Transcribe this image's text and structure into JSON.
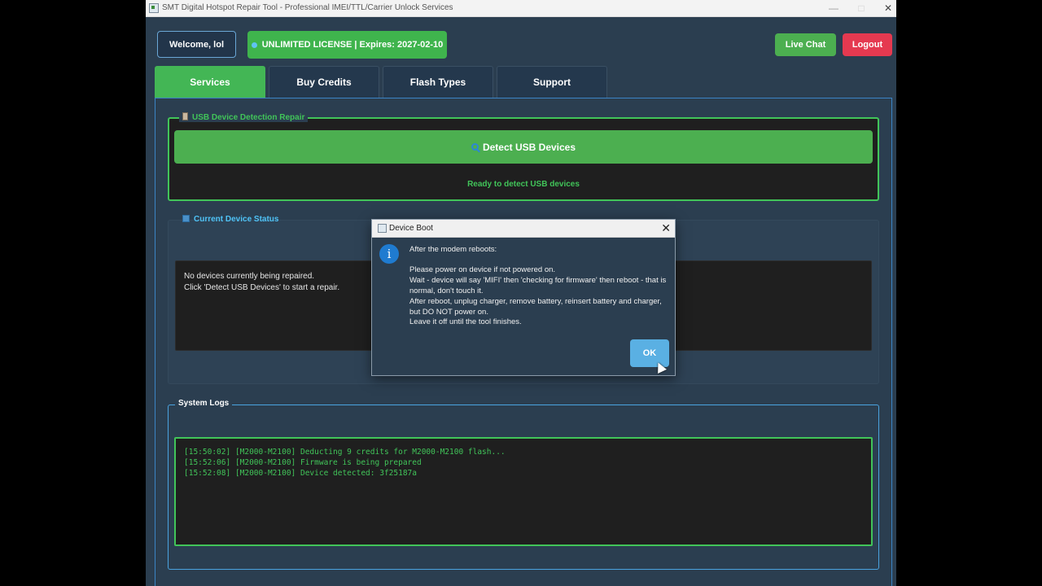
{
  "window": {
    "title": "SMT Digital Hotspot Repair Tool - Professional IMEI/TTL/Carrier Unlock Services",
    "controls": {
      "minimize": "—",
      "maximize": "□",
      "close": "✕"
    }
  },
  "header": {
    "welcome": "Welcome, lol",
    "license": "UNLIMITED LICENSE | Expires: 2027-02-10",
    "live_chat": "Live Chat",
    "logout": "Logout"
  },
  "tabs": [
    {
      "label": "Services",
      "active": true
    },
    {
      "label": "Buy Credits",
      "active": false
    },
    {
      "label": "Flash Types",
      "active": false
    },
    {
      "label": "Support",
      "active": false
    }
  ],
  "usb_section": {
    "title": "USB Device Detection  Repair",
    "detect_button": "Detect USB Devices",
    "status": "Ready to detect USB devices"
  },
  "device_status": {
    "title": "Current Device Status",
    "lines": [
      "No devices currently being repaired.",
      "Click 'Detect USB Devices' to start a repair."
    ]
  },
  "system_logs": {
    "title": "System Logs",
    "entries": [
      "[15:50:02] [M2000-M2100] Deducting 9 credits for M2000-M2100 flash...",
      "[15:52:06] [M2000-M2100] Firmware is being prepared",
      "[15:52:08] [M2000-M2100] Device detected: 3f25187a"
    ]
  },
  "dialog": {
    "title": "Device Boot",
    "close": "✕",
    "icon": "info-icon",
    "heading": "After the modem reboots:",
    "lines": [
      "Please power on device if not powered on.",
      "Wait - device will say 'MIFI' then 'checking for firmware' then reboot - that is normal, don't touch it.",
      "After reboot, unplug charger, remove battery, reinsert battery and charger, but DO NOT power on.",
      "Leave it off until the tool finishes."
    ],
    "ok_button": "OK"
  },
  "colors": {
    "background": "#2b3e50",
    "accent_green": "#43b655",
    "log_green": "#41c459",
    "logout_red": "#e53950",
    "ok_blue": "#5ab0e3"
  }
}
